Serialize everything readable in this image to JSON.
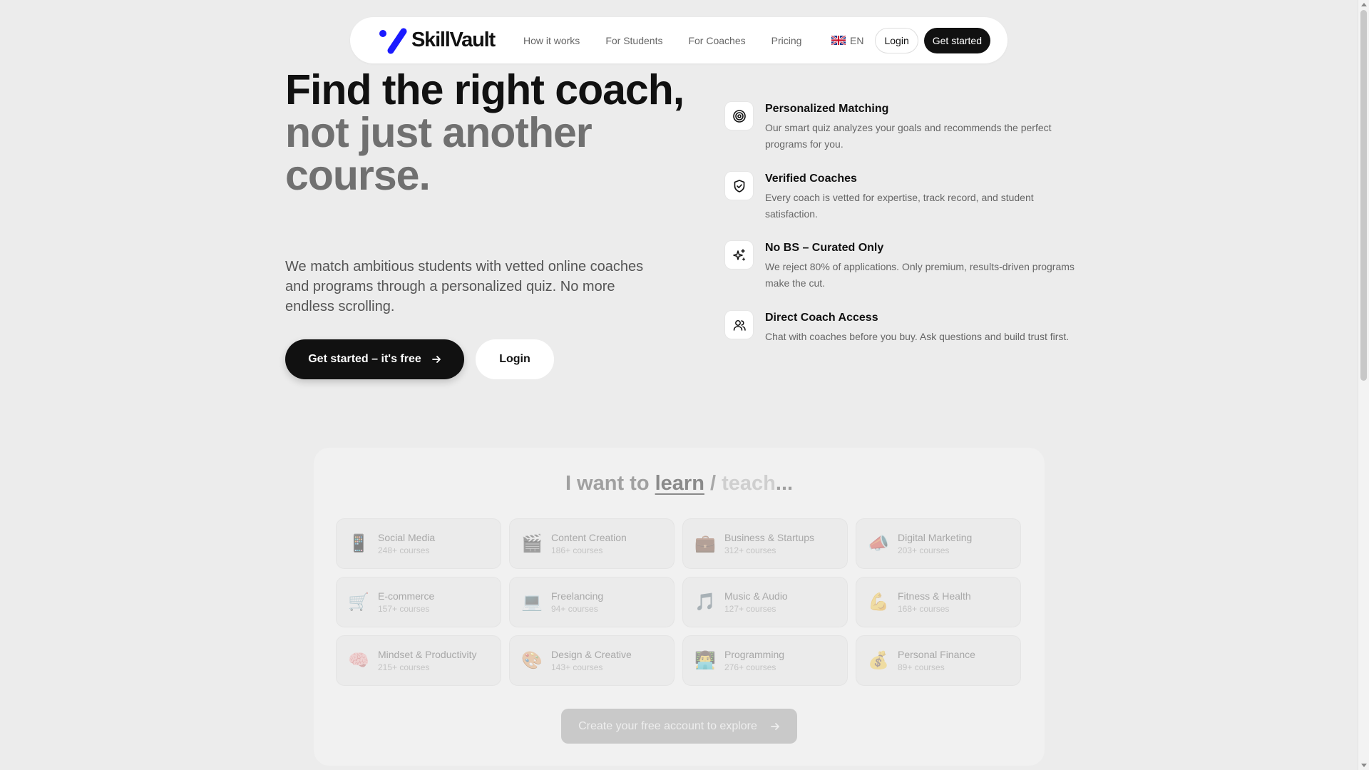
{
  "nav": {
    "logo_text": "SkillVault",
    "links": [
      "How it works",
      "For Students",
      "For Coaches",
      "Pricing"
    ],
    "language": "EN",
    "login": "Login",
    "get_started": "Get started"
  },
  "hero": {
    "title_line1": "Find the right coach,",
    "title_line2": "not just another course.",
    "subtitle": "We match ambitious students with vetted online coaches and programs through a personalized quiz. No more endless scrolling.",
    "cta_primary": "Get started – it's free",
    "cta_secondary": "Login"
  },
  "features": [
    {
      "icon": "target-icon",
      "title": "Personalized Matching",
      "desc": "Our smart quiz analyzes your goals and recommends the perfect programs for you."
    },
    {
      "icon": "shield-check-icon",
      "title": "Verified Coaches",
      "desc": "Every coach is vetted for expertise, track record, and student satisfaction."
    },
    {
      "icon": "sparkles-icon",
      "title": "No BS – Curated Only",
      "desc": "We reject 80% of applications. Only premium, results-driven programs make the cut."
    },
    {
      "icon": "users-icon",
      "title": "Direct Coach Access",
      "desc": "Chat with coaches before you buy. Ask questions and build trust first."
    }
  ],
  "quiz": {
    "heading_prefix": "I want to",
    "learn": "learn",
    "slash": "/",
    "teach": "teach",
    "dots": "...",
    "categories": [
      {
        "emoji": "📱",
        "name": "Social Media",
        "count": "248+ courses"
      },
      {
        "emoji": "🎬",
        "name": "Content Creation",
        "count": "186+ courses"
      },
      {
        "emoji": "💼",
        "name": "Business & Startups",
        "count": "312+ courses"
      },
      {
        "emoji": "📣",
        "name": "Digital Marketing",
        "count": "203+ courses"
      },
      {
        "emoji": "🛒",
        "name": "E-commerce",
        "count": "157+ courses"
      },
      {
        "emoji": "💻",
        "name": "Freelancing",
        "count": "94+ courses"
      },
      {
        "emoji": "🎵",
        "name": "Music & Audio",
        "count": "127+ courses"
      },
      {
        "emoji": "💪",
        "name": "Fitness & Health",
        "count": "168+ courses"
      },
      {
        "emoji": "🧠",
        "name": "Mindset & Productivity",
        "count": "215+ courses"
      },
      {
        "emoji": "🎨",
        "name": "Design & Creative",
        "count": "143+ courses"
      },
      {
        "emoji": "👨‍💻",
        "name": "Programming",
        "count": "276+ courses"
      },
      {
        "emoji": "💰",
        "name": "Personal Finance",
        "count": "89+ courses"
      }
    ],
    "cta": "Create your free account to explore"
  },
  "colors": {
    "brand": "#1a1aff",
    "dark": "#111111",
    "muted": "#707070"
  }
}
